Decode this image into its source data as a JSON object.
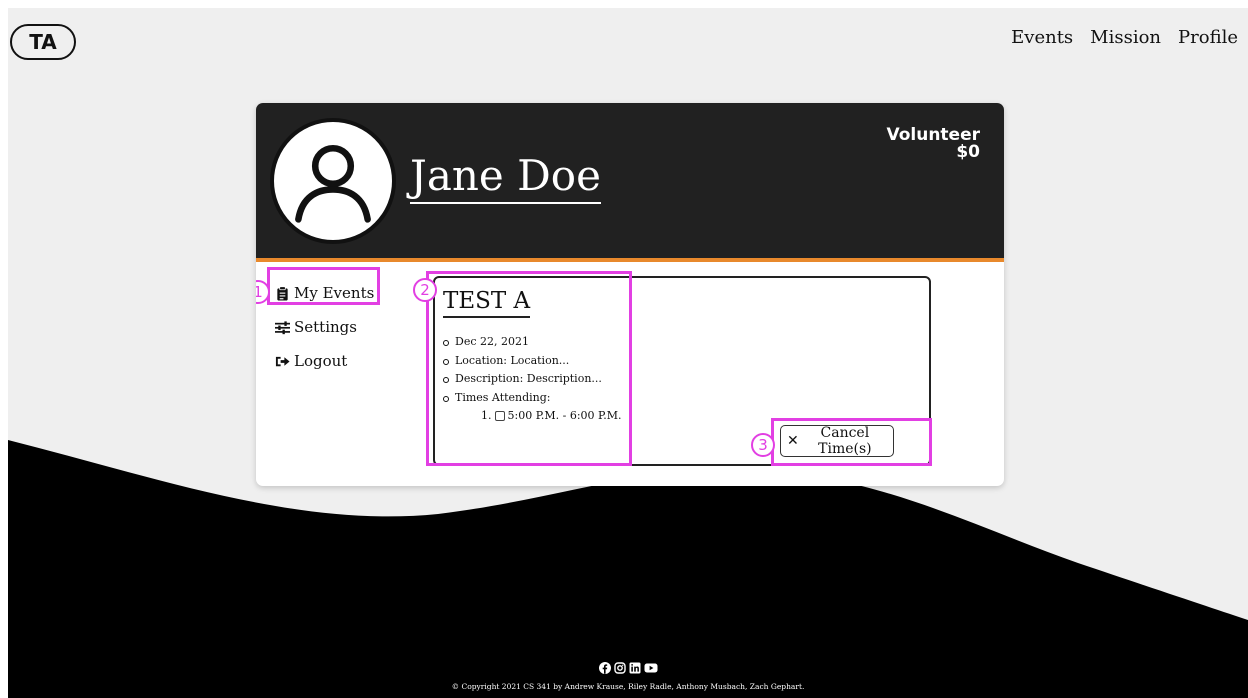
{
  "header": {
    "logo_text": "TA",
    "nav": [
      "Events",
      "Mission",
      "Profile"
    ]
  },
  "profile": {
    "name": "Jane Doe",
    "role": "Volunteer",
    "balance": "$0",
    "avatar_icon": "user-circle-icon"
  },
  "sidebar": {
    "items": [
      {
        "label": "My Events",
        "icon": "clipboard-icon"
      },
      {
        "label": "Settings",
        "icon": "sliders-icon"
      },
      {
        "label": "Logout",
        "icon": "sign-out-icon"
      }
    ]
  },
  "event": {
    "title": "TEST A",
    "date": "Dec 22, 2021",
    "location": "Location: Location...",
    "description": "Description: Description...",
    "times_label": "Times Attending:",
    "times": [
      {
        "number": "1.",
        "label": "5:00 P.M. - 6:00 P.M."
      }
    ],
    "cancel_label": "Cancel Time(s)"
  },
  "annotations": [
    "1",
    "2",
    "3"
  ],
  "footer": {
    "social_icons": [
      "facebook-icon",
      "instagram-icon",
      "linkedin-icon",
      "youtube-icon"
    ],
    "copyright": "© Copyright 2021 CS 341 by Andrew Krause, Riley Radle, Anthony Musbach, Zach Gephart."
  },
  "colors": {
    "header_bg": "#212121",
    "accent": "#e8892c",
    "annotation": "#e23fe3",
    "page_bg": "#efefef"
  }
}
